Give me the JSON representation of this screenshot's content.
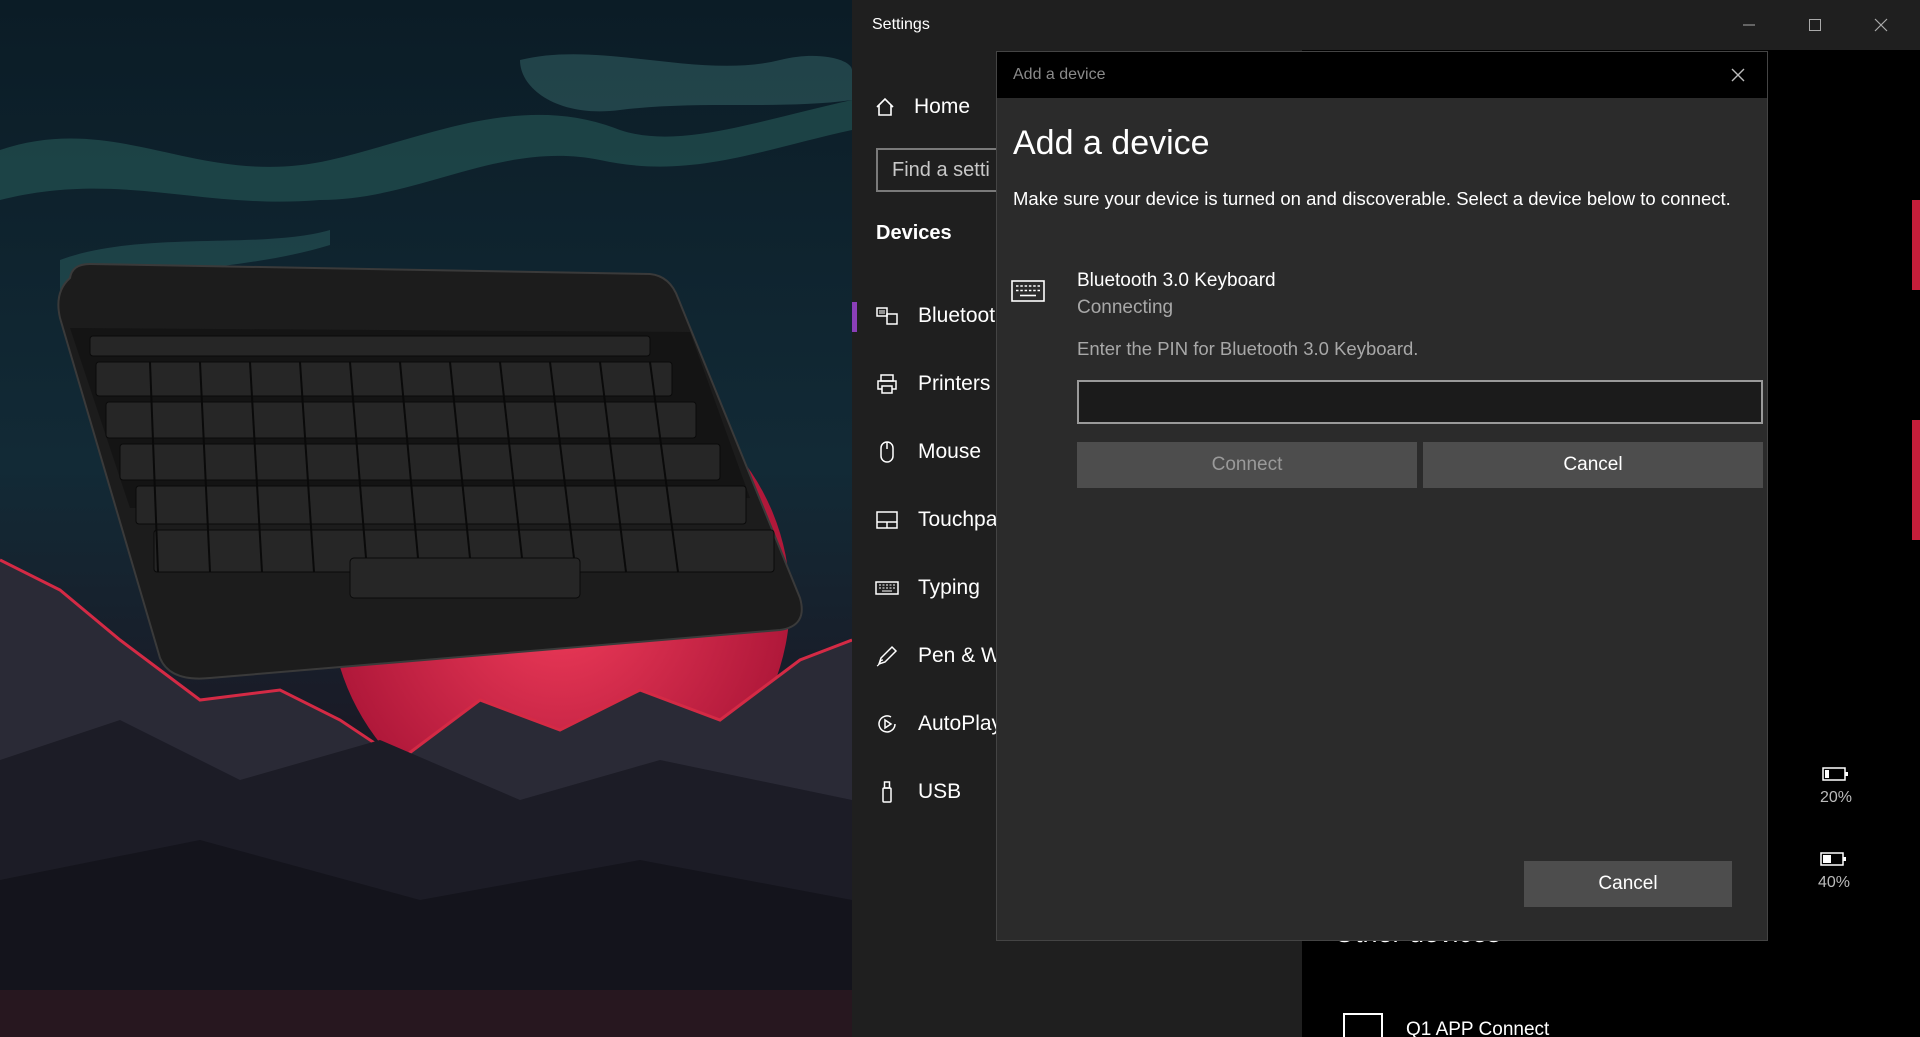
{
  "settings": {
    "title": "Settings",
    "window_controls": {
      "minimize_icon": "minimize-icon",
      "maximize_icon": "maximize-icon",
      "close_icon": "close-icon"
    },
    "nav": {
      "home_label": "Home",
      "search_placeholder": "Find a setti",
      "section_title": "Devices",
      "items": [
        {
          "label": "Bluetoot",
          "icon": "bluetooth-devices-icon",
          "active": true
        },
        {
          "label": "Printers",
          "icon": "printer-icon"
        },
        {
          "label": "Mouse",
          "icon": "mouse-icon"
        },
        {
          "label": "Touchpa",
          "icon": "touchpad-icon"
        },
        {
          "label": "Typing",
          "icon": "keyboard-icon"
        },
        {
          "label": "Pen & W",
          "icon": "pen-icon"
        },
        {
          "label": "AutoPlay",
          "icon": "autoplay-icon"
        },
        {
          "label": "USB",
          "icon": "usb-icon"
        }
      ]
    },
    "main": {
      "other_devices_title": "Other devices",
      "other_device_name": "Q1 APP Connect",
      "batteries": [
        {
          "percent": "20%"
        },
        {
          "percent": "40%"
        }
      ]
    }
  },
  "dialog": {
    "title": "Add a device",
    "heading": "Add a device",
    "description": "Make sure your device is turned on and discoverable. Select a device below to connect.",
    "device": {
      "name": "Bluetooth 3.0 Keyboard",
      "status": "Connecting",
      "pin_prompt": "Enter the PIN for Bluetooth 3.0 Keyboard.",
      "pin_value": "",
      "connect_label": "Connect",
      "cancel_label": "Cancel"
    },
    "cancel_label": "Cancel"
  },
  "colors": {
    "accent": "#8a3fb8",
    "wallpaper_red": "#d42a45",
    "dialog_bg": "#2b2b2b",
    "button_bg": "#4d4d4d"
  }
}
